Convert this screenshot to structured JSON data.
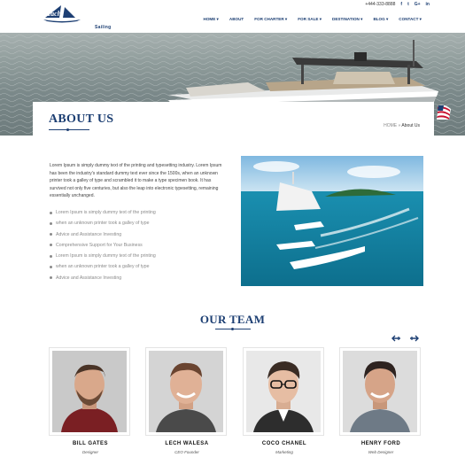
{
  "header": {
    "logo_text": "Sailing",
    "phone": "+444-333-8888",
    "social": [
      "f",
      "t",
      "G+",
      "in"
    ],
    "nav": [
      "HOME ▾",
      "ABOUT",
      "FOR CHARTER ▾",
      "FOR SALE ▾",
      "DESTINATION ▾",
      "BLOG ▾",
      "CONTACT ▾"
    ]
  },
  "about": {
    "title": "ABOUT US",
    "breadcrumb_home": "HOME",
    "breadcrumb_sep": "»",
    "breadcrumb_current": "About Us",
    "paragraph": "Lorem Ipsum is simply dummy text of the printing and typesetting industry. Lorem Ipsum has been the industry's standard dummy text ever since the 1500s, when an unknown printer took a galley of type and scrambled it to make a type specimen book. It has survived not only five centuries, but also the leap into electronic typesetting, remaining essentially unchanged.",
    "bullets": [
      "Lorem Ipsum is simply dummy text of the printing",
      "when an unknown printer took a galley of type",
      "Advice and Assistance Investing",
      "Comprehensive Support for Your Business",
      "Lorem Ipsum is simply dummy text of the printing",
      "when an unknown printer took a galley of type",
      "Advice and Assistance Investing"
    ]
  },
  "team": {
    "title": "OUR TEAM",
    "members": [
      {
        "name": "BILL GATES",
        "role": "Designer"
      },
      {
        "name": "LECH WALESA",
        "role": "CEO Founder"
      },
      {
        "name": "COCO CHANEL",
        "role": "Marketing"
      },
      {
        "name": "HENRY FORD",
        "role": "Web Designer"
      }
    ]
  },
  "colors": {
    "brand": "#1d3f73",
    "text": "#444444",
    "muted": "#8a8a8a"
  }
}
